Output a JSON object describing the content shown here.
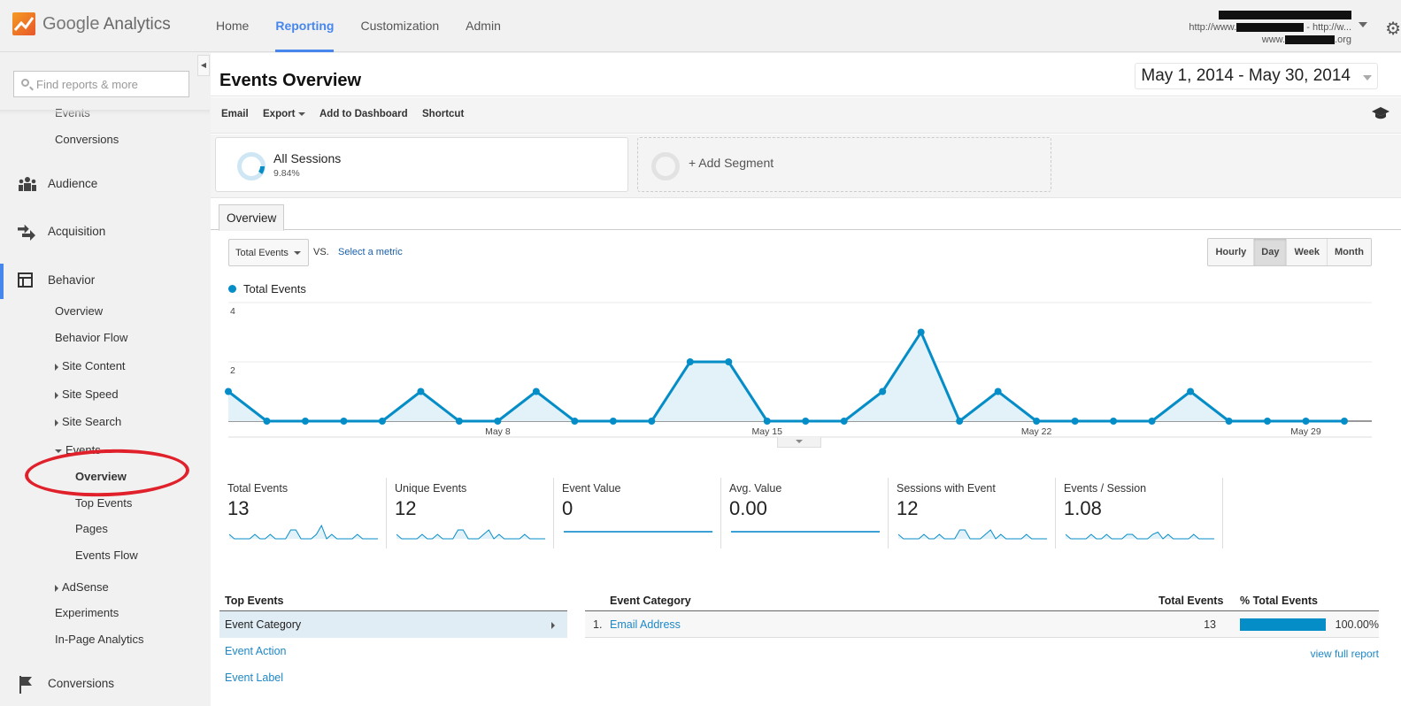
{
  "header": {
    "app_name_google": "Google",
    "app_name_analytics": "Analytics",
    "nav": [
      {
        "label": "Home",
        "active": false
      },
      {
        "label": "Reporting",
        "active": true
      },
      {
        "label": "Customization",
        "active": false
      },
      {
        "label": "Admin",
        "active": false
      }
    ],
    "account": {
      "line2_prefix": "http://www.",
      "line2_suffix": " - http://w...",
      "line3_prefix": "www.",
      "line3_suffix": ".org"
    }
  },
  "sidebar": {
    "search_placeholder": "Find reports & more",
    "items": [
      {
        "label": "Events"
      },
      {
        "label": "Conversions"
      },
      {
        "label": "Audience"
      },
      {
        "label": "Acquisition"
      },
      {
        "label": "Behavior"
      },
      {
        "label": "Overview"
      },
      {
        "label": "Behavior Flow"
      },
      {
        "label": "Site Content"
      },
      {
        "label": "Site Speed"
      },
      {
        "label": "Site Search"
      },
      {
        "label": "Events"
      },
      {
        "label": "Overview"
      },
      {
        "label": "Top Events"
      },
      {
        "label": "Pages"
      },
      {
        "label": "Events Flow"
      },
      {
        "label": "AdSense"
      },
      {
        "label": "Experiments"
      },
      {
        "label": "In-Page Analytics"
      },
      {
        "label": "Conversions"
      }
    ]
  },
  "page": {
    "title": "Events Overview",
    "date_range": "May 1, 2014 - May 30, 2014",
    "toolbar": {
      "email": "Email",
      "export": "Export",
      "add_to_dashboard": "Add to Dashboard",
      "shortcut": "Shortcut"
    },
    "segments": {
      "all_sessions": "All Sessions",
      "all_sessions_pct": "9.84%",
      "add_segment": "+ Add Segment"
    },
    "tab": "Overview",
    "metric_select": "Total Events",
    "vs": "VS.",
    "select_metric": "Select a metric",
    "granularity": [
      {
        "label": "Hourly",
        "active": false
      },
      {
        "label": "Day",
        "active": true
      },
      {
        "label": "Week",
        "active": false
      },
      {
        "label": "Month",
        "active": false
      }
    ]
  },
  "chart_data": {
    "type": "area",
    "title": "",
    "series": [
      {
        "name": "Total Events",
        "color": "#058dc7",
        "values": [
          1,
          0,
          0,
          0,
          0,
          1,
          0,
          0,
          1,
          0,
          0,
          0,
          2,
          2,
          0,
          0,
          0,
          1,
          3,
          0,
          1,
          0,
          0,
          0,
          0,
          1,
          0,
          0,
          0,
          0
        ]
      }
    ],
    "x": [
      "May 1",
      "May 2",
      "May 3",
      "May 4",
      "May 5",
      "May 6",
      "May 7",
      "May 8",
      "May 9",
      "May 10",
      "May 11",
      "May 12",
      "May 13",
      "May 14",
      "May 15",
      "May 16",
      "May 17",
      "May 18",
      "May 19",
      "May 20",
      "May 21",
      "May 22",
      "May 23",
      "May 24",
      "May 25",
      "May 26",
      "May 27",
      "May 28",
      "May 29",
      "May 30"
    ],
    "x_tick_labels": [
      {
        "index": 7,
        "label": "May 8"
      },
      {
        "index": 14,
        "label": "May 15"
      },
      {
        "index": 21,
        "label": "May 22"
      },
      {
        "index": 28,
        "label": "May 29"
      }
    ],
    "y_tick_labels": [
      "2",
      "4"
    ],
    "ylim": [
      0,
      4
    ],
    "grid": true,
    "legend": "top-left"
  },
  "scorecards": [
    {
      "label": "Total Events",
      "value": "13",
      "spark": [
        1,
        0,
        0,
        0,
        0,
        1,
        0,
        0,
        1,
        0,
        0,
        0,
        2,
        2,
        0,
        0,
        0,
        1,
        3,
        0,
        1,
        0,
        0,
        0,
        0,
        1,
        0,
        0,
        0,
        0
      ]
    },
    {
      "label": "Unique Events",
      "value": "12",
      "spark": [
        1,
        0,
        0,
        0,
        0,
        1,
        0,
        0,
        1,
        0,
        0,
        0,
        2,
        2,
        0,
        0,
        0,
        1,
        2,
        0,
        1,
        0,
        0,
        0,
        0,
        1,
        0,
        0,
        0,
        0
      ]
    },
    {
      "label": "Event Value",
      "value": "0",
      "spark": [
        0,
        0,
        0,
        0,
        0,
        0,
        0,
        0,
        0,
        0,
        0,
        0,
        0,
        0,
        0,
        0,
        0,
        0,
        0,
        0,
        0,
        0,
        0,
        0,
        0,
        0,
        0,
        0,
        0,
        0
      ]
    },
    {
      "label": "Avg. Value",
      "value": "0.00",
      "spark": [
        0,
        0,
        0,
        0,
        0,
        0,
        0,
        0,
        0,
        0,
        0,
        0,
        0,
        0,
        0,
        0,
        0,
        0,
        0,
        0,
        0,
        0,
        0,
        0,
        0,
        0,
        0,
        0,
        0,
        0
      ]
    },
    {
      "label": "Sessions with Event",
      "value": "12",
      "spark": [
        1,
        0,
        0,
        0,
        0,
        1,
        0,
        0,
        1,
        0,
        0,
        0,
        2,
        2,
        0,
        0,
        0,
        1,
        2,
        0,
        1,
        0,
        0,
        0,
        0,
        1,
        0,
        0,
        0,
        0
      ]
    },
    {
      "label": "Events / Session",
      "value": "1.08",
      "spark": [
        1,
        0,
        0,
        0,
        0,
        1,
        0,
        0,
        1,
        0,
        0,
        0,
        1,
        1,
        0,
        0,
        0,
        1,
        1.5,
        0,
        1,
        0,
        0,
        0,
        0,
        1,
        0,
        0,
        0,
        0
      ]
    }
  ],
  "top_events": {
    "heading": "Top Events",
    "items": [
      {
        "label": "Event Category",
        "active": true
      },
      {
        "label": "Event Action",
        "active": false
      },
      {
        "label": "Event Label",
        "active": false
      }
    ]
  },
  "table": {
    "headers": {
      "dimension": "Event Category",
      "metric": "Total Events",
      "pct": "% Total Events"
    },
    "rows": [
      {
        "index": "1.",
        "name": "Email Address",
        "value": "13",
        "pct": "100.00%",
        "pct_fraction": 1.0
      }
    ],
    "view_full_report": "view full report"
  }
}
